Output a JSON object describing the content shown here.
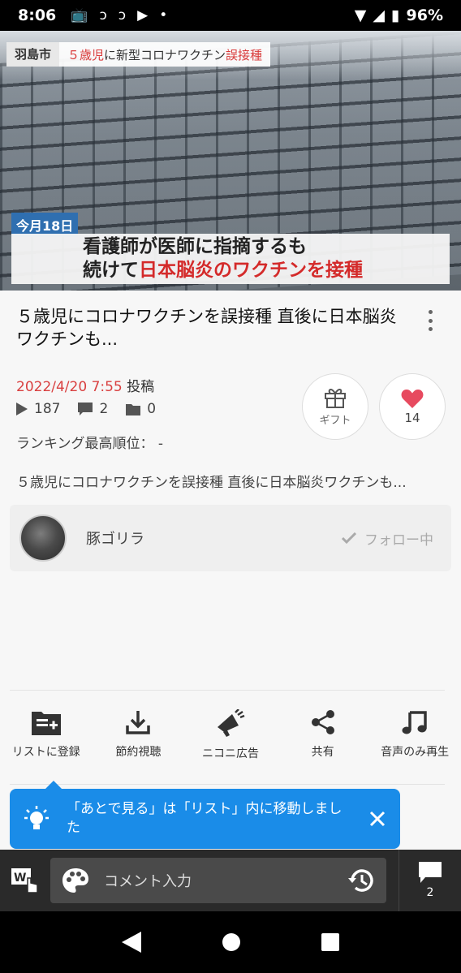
{
  "status": {
    "time": "8:06",
    "battery": "96%"
  },
  "video": {
    "city": "羽島市",
    "caption_red1": "５歳児",
    "caption_dark1": "に新型コロナワクチン",
    "caption_red2": "誤接種",
    "date_tag": "今月18日",
    "headline1": "看護師が医師に指摘するも",
    "headline2_prefix": "続けて",
    "headline2_red": "日本脳炎のワクチンを接種"
  },
  "title": "５歳児にコロナワクチンを誤接種 直後に日本脳炎ワクチンも...",
  "posted": {
    "date": "2022/4/20 7:55",
    "label": "投稿"
  },
  "stats": {
    "views": "187",
    "comments": "2",
    "mylists": "0"
  },
  "ranking": "ランキング最高順位： -",
  "gift": {
    "label": "ギフト"
  },
  "like": {
    "count": "14"
  },
  "description": "５歳児にコロナワクチンを誤接種 直後に日本脳炎ワクチンも...",
  "owner": {
    "name": "豚ゴリラ",
    "follow_label": "フォロー中"
  },
  "actions": [
    {
      "label": "リストに登録",
      "icon": "playlist-add-icon"
    },
    {
      "label": "節約視聴",
      "icon": "download-icon"
    },
    {
      "label": "ニコニ広告",
      "icon": "megaphone-icon"
    },
    {
      "label": "共有",
      "icon": "share-icon"
    },
    {
      "label": "音声のみ再生",
      "icon": "music-note-icon"
    }
  ],
  "toast": {
    "message": "「あとで見る」は「リスト」内に移動しました"
  },
  "comment_bar": {
    "placeholder": "コメント入力",
    "count": "2"
  }
}
